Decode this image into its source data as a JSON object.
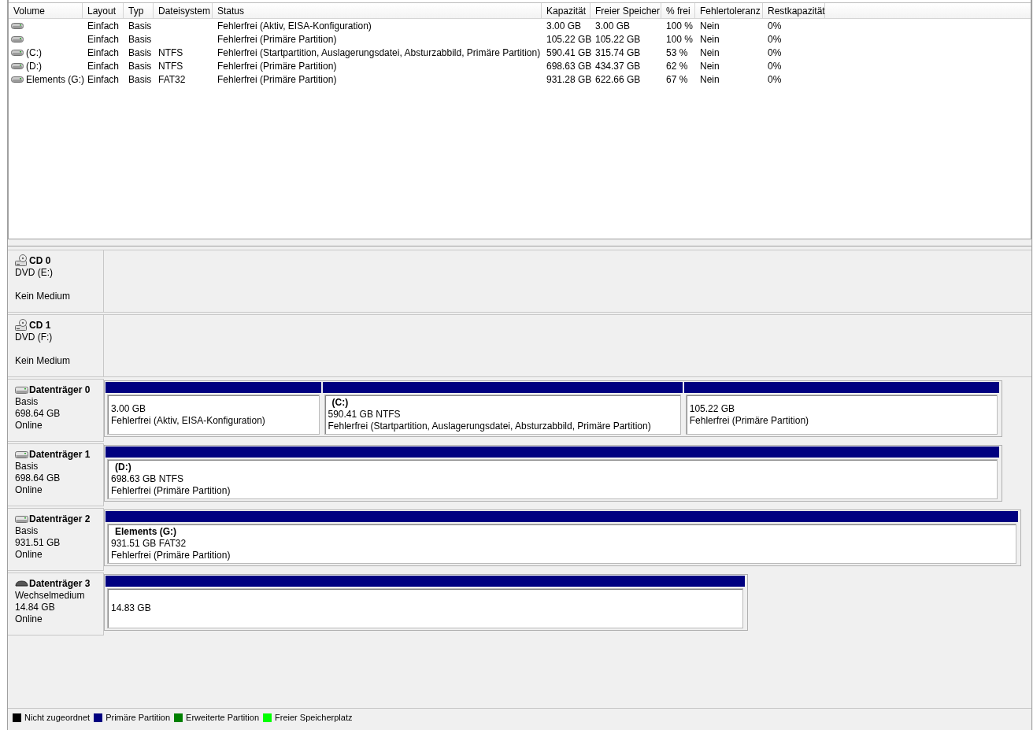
{
  "volumes": {
    "columns": [
      "Volume",
      "Layout",
      "Typ",
      "Dateisystem",
      "Status",
      "Kapazität",
      "Freier Speicher",
      "% frei",
      "Fehlertoleranz",
      "Restkapazität"
    ],
    "rows": [
      {
        "cells": [
          "",
          "Einfach",
          "Basis",
          "",
          "Fehlerfrei (Aktiv, EISA-Konfiguration)",
          "3.00 GB",
          "3.00 GB",
          "100 %",
          "Nein",
          "0%"
        ]
      },
      {
        "cells": [
          "",
          "Einfach",
          "Basis",
          "",
          "Fehlerfrei (Primäre Partition)",
          "105.22 GB",
          "105.22 GB",
          "100 %",
          "Nein",
          "0%"
        ]
      },
      {
        "cells": [
          "(C:)",
          "Einfach",
          "Basis",
          "NTFS",
          "Fehlerfrei (Startpartition, Auslagerungsdatei, Absturzabbild, Primäre Partition)",
          "590.41 GB",
          "315.74 GB",
          "53 %",
          "Nein",
          "0%"
        ]
      },
      {
        "cells": [
          "(D:)",
          "Einfach",
          "Basis",
          "NTFS",
          "Fehlerfrei (Primäre Partition)",
          "698.63 GB",
          "434.37 GB",
          "62 %",
          "Nein",
          "0%"
        ]
      },
      {
        "cells": [
          "Elements (G:)",
          "Einfach",
          "Basis",
          "FAT32",
          "Fehlerfrei (Primäre Partition)",
          "931.28 GB",
          "622.66 GB",
          "67 %",
          "Nein",
          "0%"
        ]
      }
    ]
  },
  "disks": [
    {
      "kind": "cd",
      "name": "CD 0",
      "type": "DVD (E:)",
      "status": "Kein Medium"
    },
    {
      "kind": "cd",
      "name": "CD 1",
      "type": "DVD (F:)",
      "status": "Kein Medium"
    },
    {
      "kind": "hdd",
      "name": "Datenträger 0",
      "type": "Basis",
      "size": "698.64 GB",
      "status": "Online",
      "partitions": [
        {
          "size": "3.00 GB",
          "status": "Fehlerfrei (Aktiv, EISA-Konfiguration)",
          "color": "#000080"
        },
        {
          "name": "(C:)",
          "size": "590.41 GB NTFS",
          "status": "Fehlerfrei (Startpartition, Auslagerungsdatei, Absturzabbild, Primäre Partition)",
          "color": "#000080"
        },
        {
          "size": "105.22 GB",
          "status": "Fehlerfrei (Primäre Partition)",
          "color": "#000080"
        }
      ]
    },
    {
      "kind": "hdd",
      "name": "Datenträger 1",
      "type": "Basis",
      "size": "698.64 GB",
      "status": "Online",
      "partitions": [
        {
          "name": "(D:)",
          "size": "698.63 GB NTFS",
          "status": "Fehlerfrei (Primäre Partition)",
          "color": "#000080"
        }
      ]
    },
    {
      "kind": "hdd",
      "name": "Datenträger 2",
      "type": "Basis",
      "size": "931.51 GB",
      "status": "Online",
      "partitions": [
        {
          "name": "Elements  (G:)",
          "size": "931.51 GB FAT32",
          "status": "Fehlerfrei (Primäre Partition)",
          "color": "#000080"
        }
      ]
    },
    {
      "kind": "removable",
      "name": "Datenträger 3",
      "type": "Wechselmedium",
      "size": "14.84 GB",
      "status": "Online",
      "partitions": [
        {
          "size": "14.83 GB",
          "color": "#000080"
        }
      ]
    }
  ],
  "legend": [
    {
      "label": "Nicht zugeordnet",
      "color": "#000000"
    },
    {
      "label": "Primäre Partition",
      "color": "#000080"
    },
    {
      "label": "Erweiterte Partition",
      "color": "#008000"
    },
    {
      "label": "Freier Speicherplatz",
      "color": "#00ff00"
    }
  ]
}
